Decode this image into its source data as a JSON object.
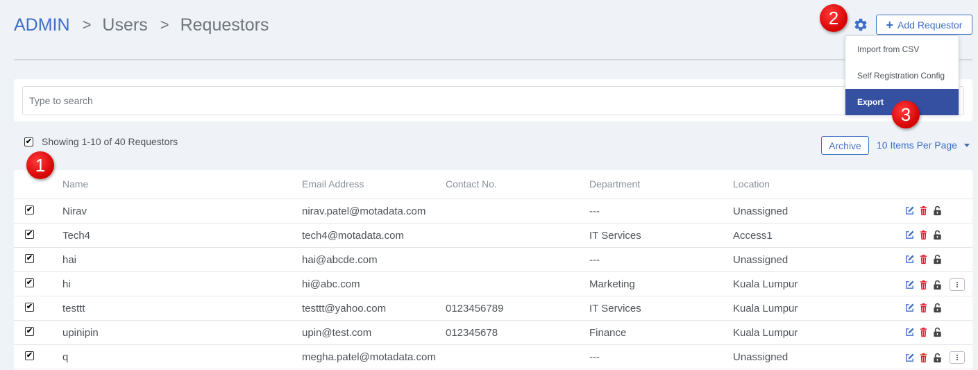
{
  "breadcrumb": {
    "root": "ADMIN",
    "sep": ">",
    "level1": "Users",
    "current": "Requestors"
  },
  "header": {
    "add_label": "Add Requestor",
    "plus": "+"
  },
  "dropdown": {
    "items": [
      "Import from CSV",
      "Self Registration Config",
      "Export"
    ],
    "active_index": 2
  },
  "badges": {
    "one": "1",
    "two": "2",
    "three": "3"
  },
  "search": {
    "placeholder": "Type to search",
    "value": ""
  },
  "summary": {
    "showing_text": "Showing 1-10 of 40 Requestors",
    "select_all_checked": true
  },
  "toolbar": {
    "archive_label": "Archive",
    "per_page_label": "10 Items Per Page"
  },
  "table": {
    "columns": {
      "name": "Name",
      "email": "Email Address",
      "contact": "Contact No.",
      "department": "Department",
      "location": "Location"
    },
    "rows": [
      {
        "name": "Nirav",
        "email": "nirav.patel@motadata.com",
        "contact": "",
        "department": "---",
        "location": "Unassigned",
        "checked": true,
        "more": false
      },
      {
        "name": "Tech4",
        "email": "tech4@motadata.com",
        "contact": "",
        "department": "IT Services",
        "location": "Access1",
        "checked": true,
        "more": false
      },
      {
        "name": "hai",
        "email": "hai@abcde.com",
        "contact": "",
        "department": "---",
        "location": "Unassigned",
        "checked": true,
        "more": false
      },
      {
        "name": "hi",
        "email": "hi@abc.com",
        "contact": "",
        "department": "Marketing",
        "location": "Kuala Lumpur",
        "checked": true,
        "more": true
      },
      {
        "name": "testtt",
        "email": "testtt@yahoo.com",
        "contact": "0123456789",
        "department": "IT Services",
        "location": "Kuala Lumpur",
        "checked": true,
        "more": false
      },
      {
        "name": "upinipin",
        "email": "upin@test.com",
        "contact": "012345678",
        "department": "Finance",
        "location": "Kuala Lumpur",
        "checked": true,
        "more": false
      },
      {
        "name": "q",
        "email": "megha.patel@motadata.com",
        "contact": "",
        "department": "---",
        "location": "Unassigned",
        "checked": true,
        "more": true
      }
    ]
  },
  "icons": {
    "settings": "gear-icon",
    "edit": "edit-icon",
    "delete": "trash-icon",
    "lock": "unlock-icon",
    "more": "more-vertical-icon",
    "check": "✔"
  },
  "colors": {
    "accent": "#3e6fc4",
    "dropdown_active": "#3550a0",
    "delete": "#e0202a",
    "badge": "#e00000",
    "background": "#eff3f7"
  }
}
